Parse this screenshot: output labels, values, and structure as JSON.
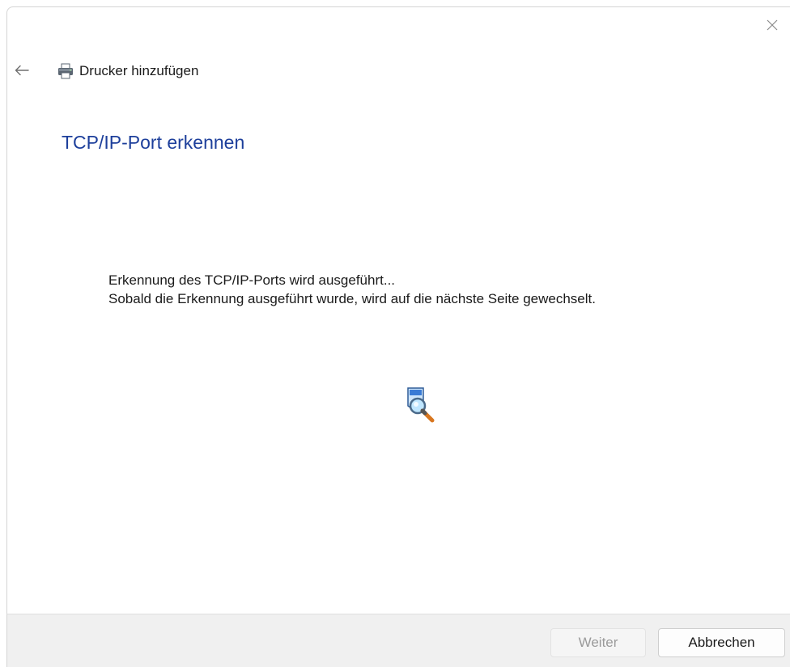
{
  "window": {
    "title": "Drucker hinzufügen",
    "icons": {
      "close": "close-icon",
      "back": "back-arrow-icon",
      "app": "printer-icon"
    }
  },
  "main": {
    "heading": "TCP/IP-Port erkennen",
    "status_line_1": "Erkennung des TCP/IP-Ports wird ausgeführt...",
    "status_line_2": "Sobald die Erkennung ausgeführt wurde, wird auf die nächste Seite gewechselt.",
    "animation_icon": "search-magnifier-icon"
  },
  "footer": {
    "next_label": "Weiter",
    "next_enabled": false,
    "cancel_label": "Abbrechen"
  },
  "colors": {
    "heading": "#1d3f9b",
    "footer_bg": "#f0f0f0",
    "disabled_text": "#9a9a9a"
  }
}
